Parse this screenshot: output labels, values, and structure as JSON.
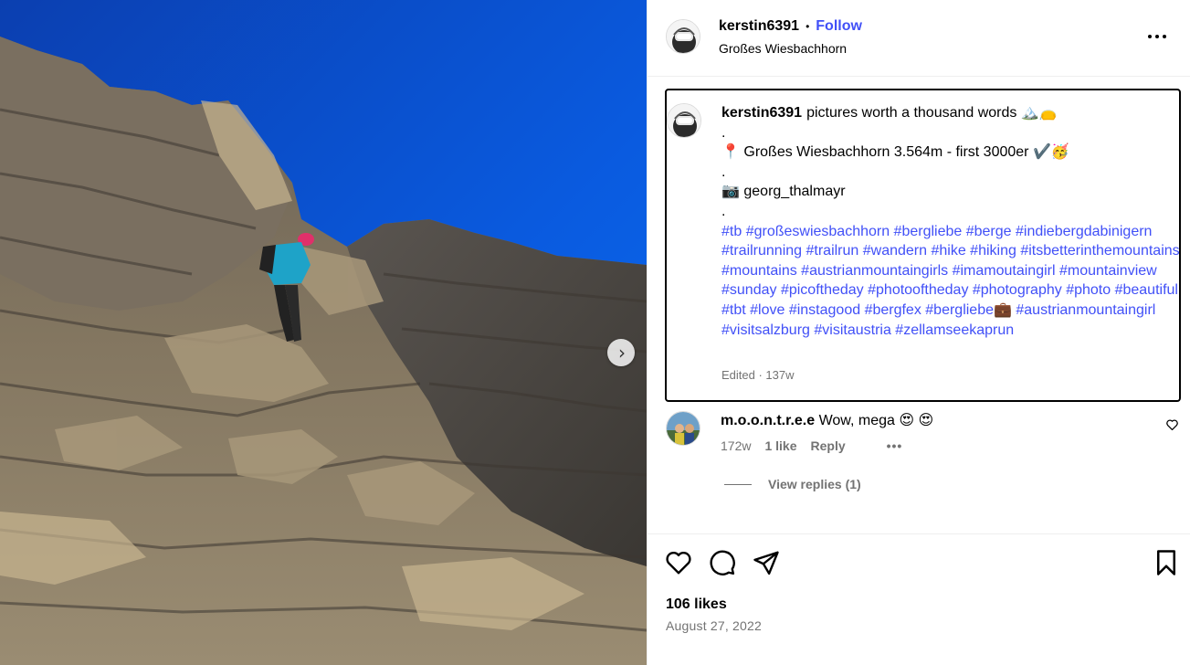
{
  "post": {
    "username": "kerstin6391",
    "follow_label": "Follow",
    "separator": "•",
    "location": "Großes Wiesbachhorn",
    "more_icon": "more-horizontal-icon"
  },
  "caption": {
    "username": "kerstin6391",
    "line1": "pictures worth a thousand words 🏔️👝",
    "line2": ".",
    "line3": "📍 Großes Wiesbachhorn 3.564m - first 3000er ✔️🥳",
    "line4": ".",
    "line5": "📷 georg_thalmayr",
    "line6": ".",
    "hashtags": "#tb #großeswiesbachhorn #bergliebe #berge #indiebergdabinigern #trailrunning #trailrun #wandern #hike #hiking #itsbetterinthemountains #mountains #austrianmountaingirls #imamoutaingirl #mountainview #sunday #picoftheday #photooftheday #photography #photo #beautiful #tbt #love #instagood #bergfex #bergliebe💼 #austrianmountaingirl #visitsalzburg #visitaustria #zellamseekaprun",
    "edited": "Edited · 137w"
  },
  "comment": {
    "username": "m.o.o.n.t.r.e.e",
    "text": "Wow, mega 😍 😍",
    "age": "172w",
    "likes": "1 like",
    "reply_label": "Reply",
    "more": "•••",
    "view_replies": "View replies (1)"
  },
  "footer": {
    "likes": "106 likes",
    "date": "August 27, 2022"
  },
  "colors": {
    "link_blue": "#4150f7",
    "muted_gray": "#737373",
    "sky_blue": "#0a55d6"
  }
}
